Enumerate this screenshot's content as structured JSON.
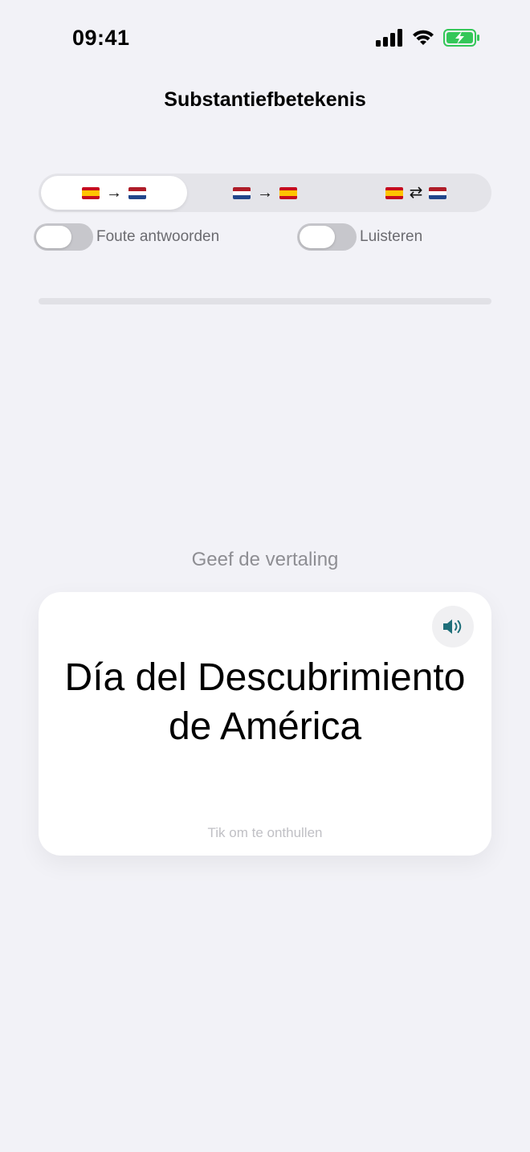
{
  "status_bar": {
    "time": "09:41",
    "battery_color": "#34c759"
  },
  "header": {
    "title": "Substantiefbetekenis"
  },
  "direction_selector": {
    "options": [
      {
        "from_flag": "flag-es",
        "arrow": "→",
        "to_flag": "flag-nl",
        "selected": true
      },
      {
        "from_flag": "flag-nl",
        "arrow": "→",
        "to_flag": "flag-es",
        "selected": false
      },
      {
        "from_flag": "flag-es",
        "arrow": "⇄",
        "to_flag": "flag-nl",
        "selected": false
      }
    ]
  },
  "toggles": {
    "wrong_answers": {
      "label": "Foute antwoorden",
      "on": false
    },
    "listening": {
      "label": "Luisteren",
      "on": false
    }
  },
  "progress": {
    "fraction": 0
  },
  "quiz": {
    "prompt": "Geef de vertaling",
    "word": "Día del Descubrimiento de América",
    "hint": "Tik om te onthullen",
    "speaker_icon": "speaker-icon"
  },
  "colors": {
    "background": "#f2f2f7",
    "speaker_icon": "#1f6f7a"
  }
}
